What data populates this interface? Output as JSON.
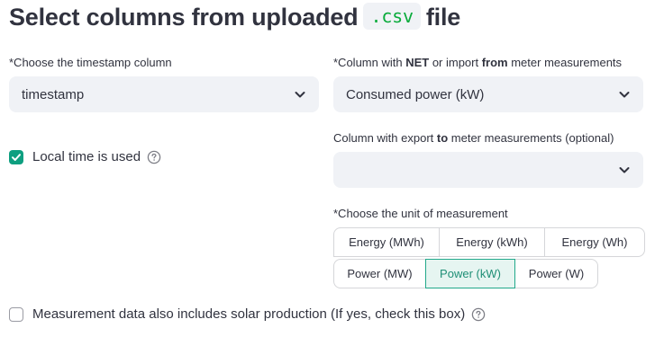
{
  "header": {
    "title_before": "Select columns from uploaded",
    "title_code": ".csv",
    "title_after": "file"
  },
  "timestamp_select": {
    "label": "*Choose the timestamp column",
    "value": "timestamp"
  },
  "net_select": {
    "label_prefix": "*Column with ",
    "label_bold1": "NET",
    "label_mid": " or import ",
    "label_bold2": "from",
    "label_suffix": " meter measurements",
    "value": "Consumed power (kW)"
  },
  "export_select": {
    "label_prefix": "Column with export ",
    "label_bold": "to",
    "label_suffix": " meter measurements (optional)",
    "value": ""
  },
  "local_time": {
    "label": "Local time is used",
    "checked": true
  },
  "unit": {
    "label": "*Choose the unit of measurement",
    "row1": [
      "Energy (MWh)",
      "Energy (kWh)",
      "Energy (Wh)"
    ],
    "row2": [
      "Power (MW)",
      "Power (kW)",
      "Power (W)"
    ],
    "selected": "Power (kW)"
  },
  "solar": {
    "label": "Measurement data also includes solar production (If yes, check this box)",
    "checked": false
  },
  "colors": {
    "accent": "#0e9f80",
    "selected_bg": "#e6f5f1",
    "input_bg": "#f0f2f6",
    "code_green": "#09ab3b"
  }
}
